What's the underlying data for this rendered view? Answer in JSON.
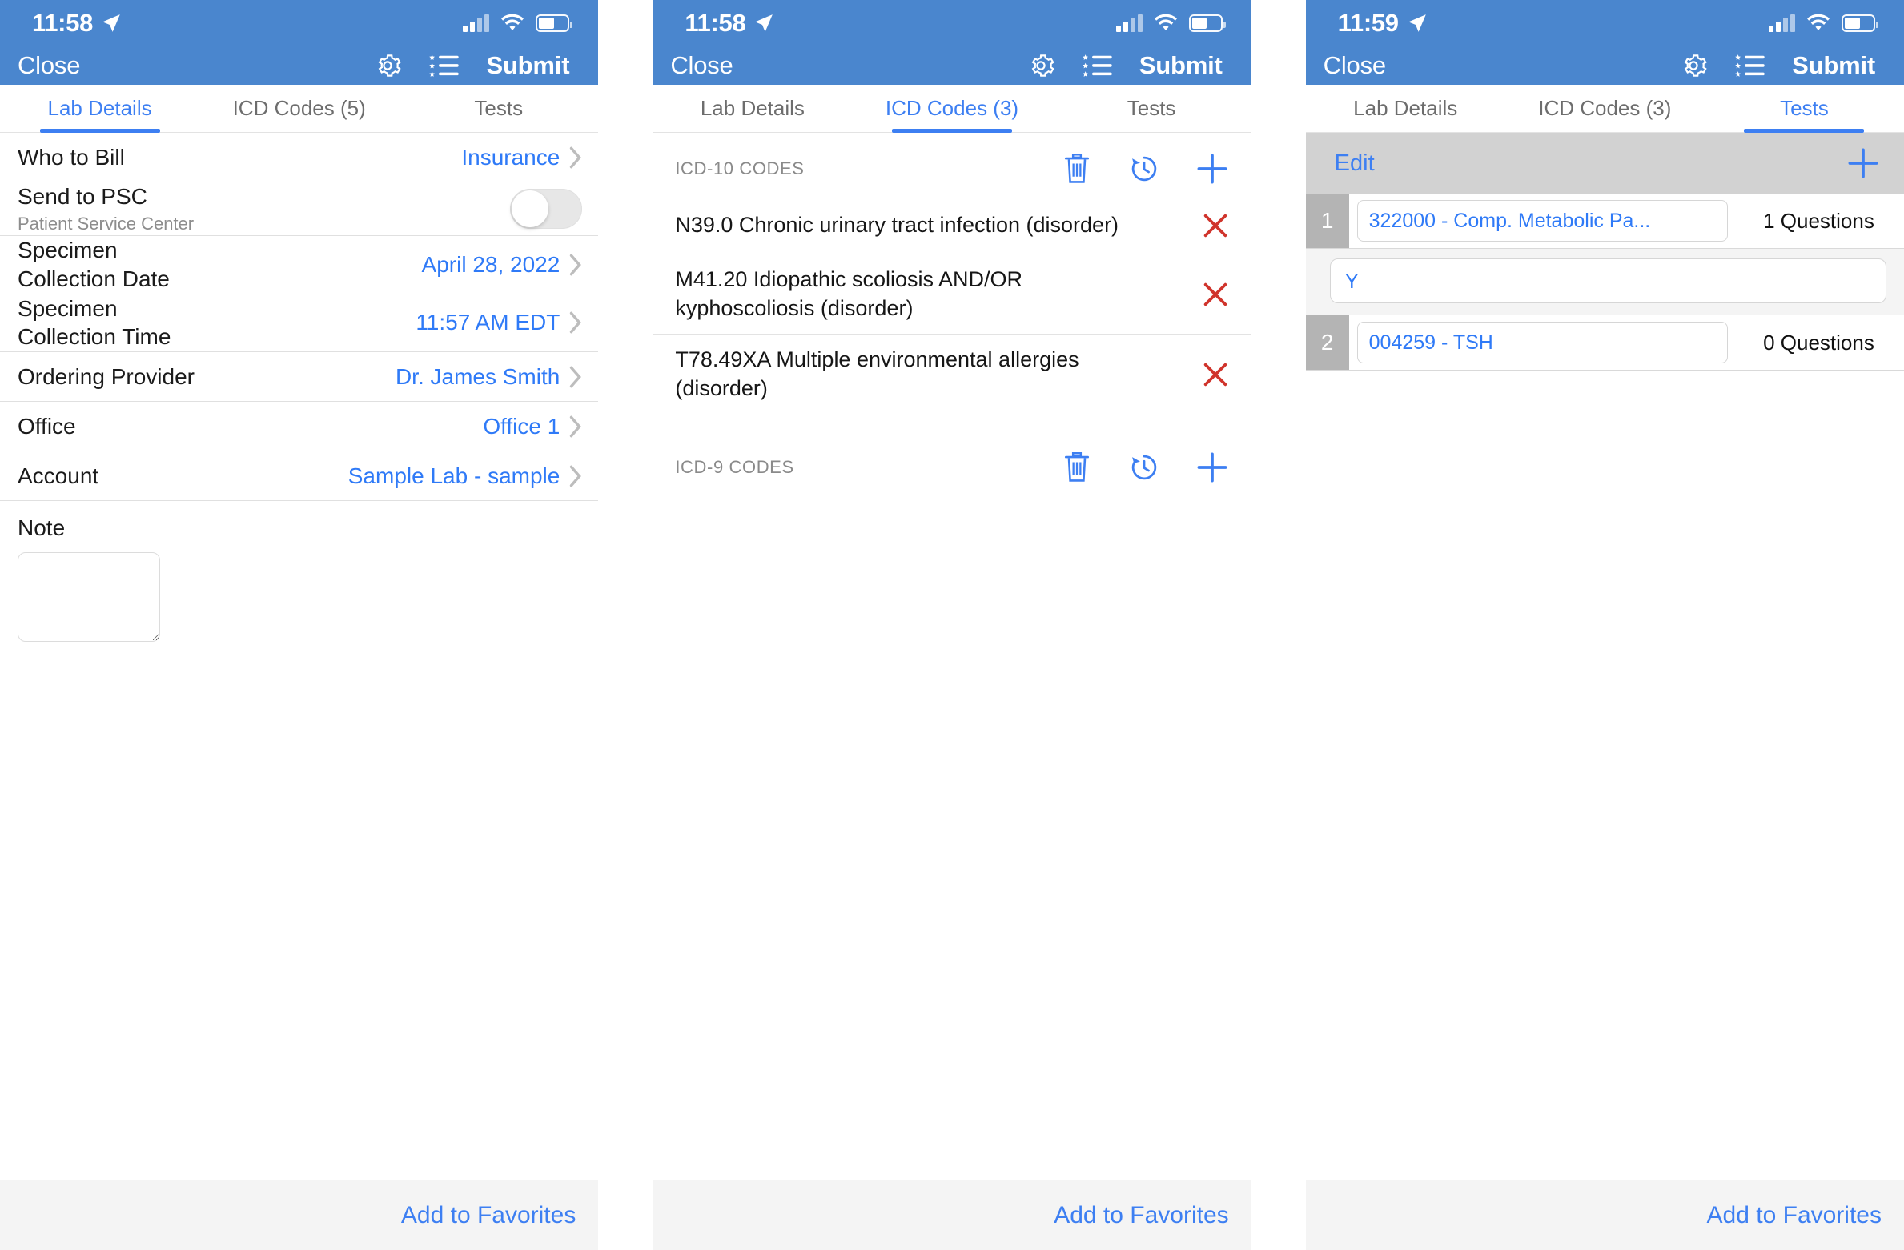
{
  "panels": [
    {
      "status": {
        "time": "11:58",
        "location_icon": "location-arrow-icon",
        "signal_icon": "cellular-signal-icon",
        "wifi_icon": "wifi-icon",
        "battery_icon": "battery-icon"
      },
      "nav": {
        "close_label": "Close",
        "settings_icon": "gear-icon",
        "list_icon": "star-list-icon",
        "submit_label": "Submit"
      },
      "tabs": [
        {
          "label": "Lab Details",
          "active": true
        },
        {
          "label": "ICD Codes (5)",
          "active": false
        },
        {
          "label": "Tests",
          "active": false
        }
      ],
      "rows": [
        {
          "label": "Who to Bill",
          "sub": "",
          "value": "Insurance",
          "control": "chevron"
        },
        {
          "label": "Send to PSC",
          "sub": "Patient Service Center",
          "value": "",
          "control": "toggle",
          "toggle_on": false
        },
        {
          "label": "Specimen\nCollection Date",
          "sub": "",
          "value": "April 28, 2022",
          "control": "chevron"
        },
        {
          "label": "Specimen\nCollection Time",
          "sub": "",
          "value": "11:57 AM EDT",
          "control": "chevron"
        },
        {
          "label": "Ordering Provider",
          "sub": "",
          "value": "Dr. James Smith",
          "control": "chevron"
        },
        {
          "label": "Office",
          "sub": "",
          "value": "Office 1",
          "control": "chevron"
        },
        {
          "label": "Account",
          "sub": "",
          "value": "Sample Lab - sample",
          "control": "chevron"
        }
      ],
      "note": {
        "label": "Note",
        "value": "",
        "placeholder": ""
      },
      "footer": {
        "favorites_label": "Add to Favorites"
      }
    },
    {
      "status": {
        "time": "11:58",
        "location_icon": "location-arrow-icon",
        "signal_icon": "cellular-signal-icon",
        "wifi_icon": "wifi-icon",
        "battery_icon": "battery-icon"
      },
      "nav": {
        "close_label": "Close",
        "settings_icon": "gear-icon",
        "list_icon": "star-list-icon",
        "submit_label": "Submit"
      },
      "tabs": [
        {
          "label": "Lab Details",
          "active": false
        },
        {
          "label": "ICD Codes (3)",
          "active": true
        },
        {
          "label": "Tests",
          "active": false
        }
      ],
      "icd10": {
        "title": "ICD-10 CODES",
        "actions": {
          "delete_icon": "trash-icon",
          "history_icon": "history-clock-icon",
          "add_icon": "plus-icon"
        },
        "codes": [
          {
            "text": "N39.0 Chronic urinary tract infection (disorder)",
            "remove_icon": "remove-x-icon"
          },
          {
            "text": "M41.20 Idiopathic scoliosis AND/OR kyphoscoliosis (disorder)",
            "remove_icon": "remove-x-icon"
          },
          {
            "text": "T78.49XA Multiple environmental allergies (disorder)",
            "remove_icon": "remove-x-icon"
          }
        ]
      },
      "icd9": {
        "title": "ICD-9 CODES",
        "actions": {
          "delete_icon": "trash-icon",
          "history_icon": "history-clock-icon",
          "add_icon": "plus-icon"
        },
        "codes": []
      },
      "footer": {
        "favorites_label": "Add to Favorites"
      }
    },
    {
      "status": {
        "time": "11:59",
        "location_icon": "location-arrow-icon",
        "signal_icon": "cellular-signal-icon",
        "wifi_icon": "wifi-icon",
        "battery_icon": "battery-icon"
      },
      "nav": {
        "close_label": "Close",
        "settings_icon": "gear-icon",
        "list_icon": "star-list-icon",
        "submit_label": "Submit"
      },
      "tabs": [
        {
          "label": "Lab Details",
          "active": false
        },
        {
          "label": "ICD Codes (3)",
          "active": false
        },
        {
          "label": "Tests",
          "active": true
        }
      ],
      "tests_bar": {
        "edit_label": "Edit",
        "add_icon": "plus-icon"
      },
      "tests": [
        {
          "num": "1",
          "name": "322000 - Comp. Metabolic Pa...",
          "questions": "1 Questions",
          "answer": "Y",
          "has_answer": true
        },
        {
          "num": "2",
          "name": "004259 - TSH",
          "questions": "0 Questions",
          "answer": "",
          "has_answer": false
        }
      ],
      "footer": {
        "favorites_label": "Add to Favorites"
      }
    }
  ],
  "colors": {
    "header_blue": "#4a86ce",
    "accent_blue": "#3d7ff2",
    "link_blue": "#2f7af7",
    "remove_red": "#d0342c",
    "tests_bar_gray": "#d2d2d2",
    "row_num_gray": "#b4b4b4",
    "footer_gray": "#f4f4f4"
  }
}
